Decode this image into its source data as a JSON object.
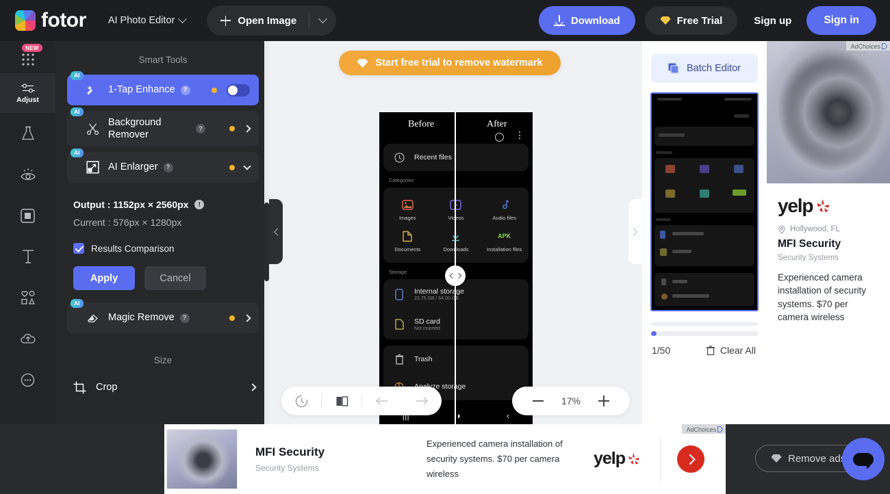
{
  "topbar": {
    "brand": "fotor",
    "product_menu": "AI Photo Editor",
    "open_image": "Open Image",
    "download": "Download",
    "free_trial": "Free Trial",
    "sign_up": "Sign up",
    "sign_in": "Sign in",
    "accent_blue": "#5a6df0"
  },
  "rail": {
    "new_badge": "NEW",
    "items": [
      {
        "name": "apps-grid-icon",
        "label": ""
      },
      {
        "name": "adjust-icon",
        "label": "Adjust"
      },
      {
        "name": "flask-icon",
        "label": ""
      },
      {
        "name": "eye-icon",
        "label": ""
      },
      {
        "name": "frame-icon",
        "label": ""
      },
      {
        "name": "text-icon",
        "label": ""
      },
      {
        "name": "shapes-icon",
        "label": ""
      },
      {
        "name": "cloud-upload-icon",
        "label": ""
      },
      {
        "name": "sticker-icon",
        "label": ""
      }
    ]
  },
  "panel": {
    "title": "Smart Tools",
    "ai_badge": "AI",
    "help_glyph": "?",
    "tools": [
      {
        "label": "1-Tap Enhance",
        "icon": "magic-wand-icon",
        "state": "toggle",
        "pro_dot": true
      },
      {
        "label": "Background Remover",
        "icon": "scissors-icon",
        "state": "chevron-right",
        "pro_dot": true
      },
      {
        "label": "AI Enlarger",
        "icon": "enlarge-icon",
        "state": "chevron-down",
        "pro_dot": true
      }
    ],
    "output_label": "Output : 1152px × 2560px",
    "current_label": "Current : 576px × 1280px",
    "results_comparison": "Results Comparison",
    "apply": "Apply",
    "cancel": "Cancel",
    "magic_remove": {
      "label": "Magic Remove",
      "icon": "eraser-icon",
      "state": "chevron-right",
      "pro_dot": true
    },
    "size_section": "Size",
    "crop": "Crop"
  },
  "canvas": {
    "watermark_cta": "Start free trial to remove watermark",
    "before_label": "Before",
    "after_label": "After",
    "phone": {
      "recent_files": "Recent files",
      "categories_label": "Categories",
      "categories": [
        {
          "label": "Images",
          "icon": "image-icon"
        },
        {
          "label": "Videos",
          "icon": "video-icon"
        },
        {
          "label": "Audio files",
          "icon": "audio-icon"
        },
        {
          "label": "Documents",
          "icon": "document-icon"
        },
        {
          "label": "Downloads",
          "icon": "download-icon"
        },
        {
          "label": "Installation files",
          "icon": "apk-icon",
          "badge": "APK"
        }
      ],
      "storage_label": "Storage",
      "storage": [
        {
          "label": "Internal storage",
          "sub": "23.75 GB / 64.00 GB",
          "icon": "phone-icon"
        },
        {
          "label": "SD card",
          "sub": "Not inserted",
          "icon": "sdcard-icon"
        }
      ],
      "actions": [
        {
          "label": "Trash",
          "icon": "trash-icon"
        },
        {
          "label": "Analyze storage",
          "icon": "analyze-icon"
        }
      ]
    },
    "zoom_level": "17%",
    "toolbar_icons": [
      "history-icon",
      "compare-icon",
      "undo-icon",
      "redo-icon"
    ],
    "zoom_out": "−",
    "zoom_in": "+"
  },
  "batch": {
    "button": "Batch Editor",
    "count": "1/50",
    "clear_all": "Clear All"
  },
  "ad_sidebar": {
    "adchoices": "AdChoices",
    "brand": "yelp",
    "location": "Hollywood, FL",
    "title": "MFI Security",
    "category": "Security Systems",
    "description": "Experienced camera installation of security systems. $70 per camera wireless"
  },
  "ad_banner": {
    "adchoices": "AdChoices",
    "title": "MFI Security",
    "category": "Security Systems",
    "description": "Experienced camera installation of security systems. $70 per camera wireless",
    "brand": "yelp"
  },
  "footer": {
    "remove_ads": "Remove ads"
  }
}
